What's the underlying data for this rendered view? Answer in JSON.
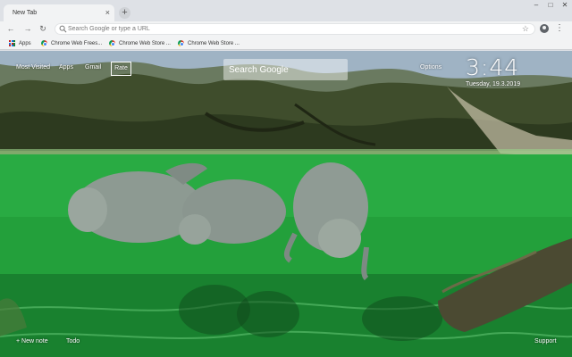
{
  "browser": {
    "tab_title": "New Tab",
    "tab_close": "×",
    "new_tab": "+",
    "window_controls": [
      "–",
      "□",
      "✕"
    ],
    "back": "←",
    "forward": "→",
    "reload": "↻",
    "omnibox_placeholder": "Search Google or type a URL",
    "star": "☆",
    "menu": "⋮"
  },
  "bookmarks": [
    {
      "label": "Apps",
      "icon": "apps-grid-icon"
    },
    {
      "label": "Chrome Web Frees...",
      "icon": "chrome-web-store-icon"
    },
    {
      "label": "Chrome Web Store ...",
      "icon": "chrome-web-store-icon"
    },
    {
      "label": "Chrome Web Store ...",
      "icon": "chrome-web-store-icon"
    }
  ],
  "newtab": {
    "links": {
      "most_visited": "Most Visited",
      "apps": "Apps",
      "gmail": "Gmail",
      "rate": "Rate"
    },
    "search_placeholder": "Search Google",
    "options": "Options",
    "time": "3:44",
    "date": "Tuesday, 19.3.2019",
    "footer": {
      "new_note": "+ New note",
      "todo": "Todo",
      "support": "Support"
    }
  },
  "colors": {
    "water": "#22a33b",
    "manatee": "#8d9a92",
    "chrome_frame": "#dee1e6"
  }
}
